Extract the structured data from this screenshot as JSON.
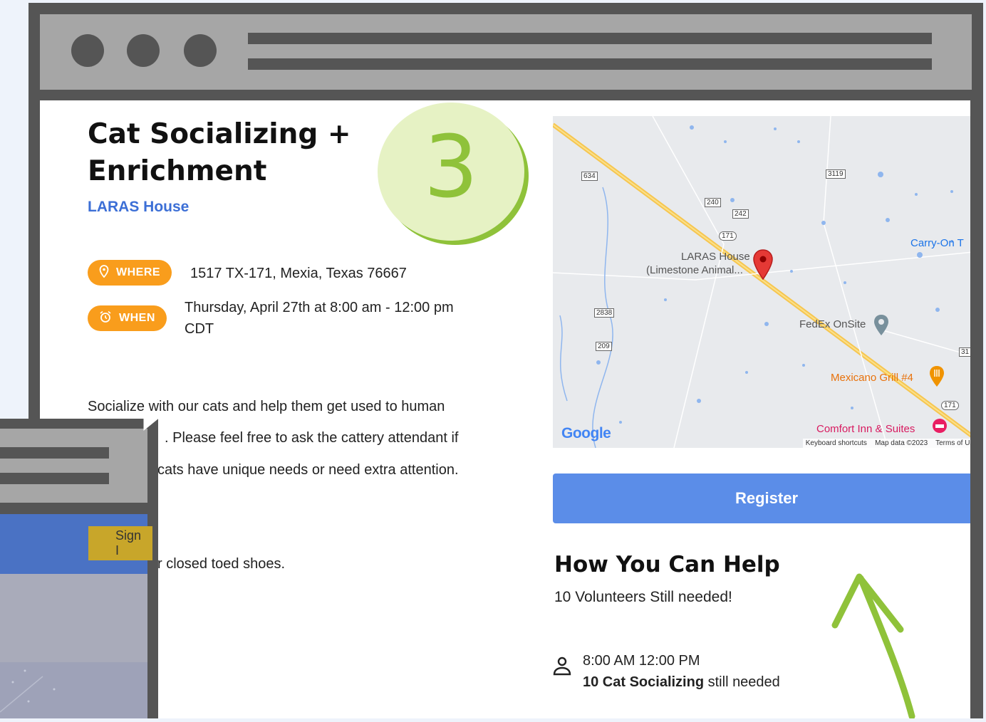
{
  "step_number": "3",
  "event": {
    "title": "Cat Socializing + Enrichment",
    "organization": "LARAS House",
    "where_label": "WHERE",
    "where_value": "1517 TX-171, Mexia, Texas 76667",
    "when_label": "WHEN",
    "when_value_line1": "Thursday, April 27th at 8:00 am - 12:00 pm",
    "when_value_line2": "CDT",
    "description_line1": "Socialize with our cats and help them get used to human",
    "description_line2": ". Please feel free to ask the cattery attendant if",
    "description_line3": "cats have unique needs or need extra attention.",
    "description_line4": "r closed toed shoes."
  },
  "map": {
    "route_labels": [
      "634",
      "3119",
      "240",
      "242",
      "171",
      "2838",
      "209",
      "31",
      "171"
    ],
    "pin_label_line1": "LARAS House",
    "pin_label_line2": "(Limestone Animal...",
    "place_fedex": "FedEx OnSite",
    "place_mexicano": "Mexicano Grill #4",
    "place_comfort": "Comfort Inn & Suites",
    "place_carryon": "Carry-On T",
    "google_logo": "Google",
    "footer_shortcuts": "Keyboard shortcuts",
    "footer_data": "Map data ©2023",
    "footer_terms": "Terms of Use"
  },
  "register_label": "Register",
  "help": {
    "title": "How You Can Help",
    "subtitle": "10 Volunteers Still needed!",
    "shift_time": "8:00 AM 12:00 PM",
    "shift_role": "10 Cat Socializing",
    "shift_suffix": " still needed"
  },
  "secondary_window": {
    "signin_label": "Sign I"
  },
  "colors": {
    "frame": "#555555",
    "titlebar": "#a6a6a6",
    "badge_orange": "#f99d1c",
    "link_blue": "#3c6fd6",
    "register_blue": "#5b8de8",
    "accent_green": "#8fc23a"
  }
}
